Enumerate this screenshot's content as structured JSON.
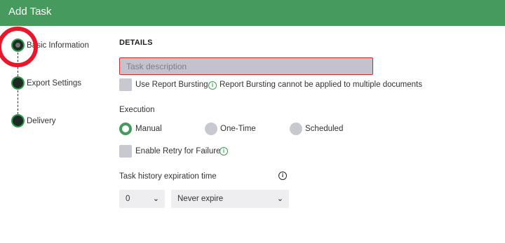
{
  "window": {
    "title": "Add Task"
  },
  "stepper": {
    "steps": [
      {
        "label": "Basic Information",
        "active": true
      },
      {
        "label": "Export Settings",
        "active": false
      },
      {
        "label": "Delivery",
        "active": false
      }
    ]
  },
  "details": {
    "section_title": "DETAILS",
    "task_description": {
      "value": "",
      "placeholder": "Task description"
    },
    "report_bursting": {
      "label": "Use Report Bursting",
      "checked": false,
      "note": "Report Bursting cannot be applied to multiple documents"
    },
    "execution": {
      "label": "Execution",
      "options": [
        {
          "label": "Manual",
          "selected": true
        },
        {
          "label": "One-Time",
          "selected": false
        },
        {
          "label": "Scheduled",
          "selected": false
        }
      ]
    },
    "retry": {
      "label": "Enable Retry for Failure",
      "checked": false
    },
    "history": {
      "label": "Task history expiration time",
      "amount": "0",
      "unit": "Never expire"
    }
  },
  "colors": {
    "accent": "#479a5d",
    "annotation": "#e8172b",
    "error_border": "#cc2b2b"
  },
  "icons": {
    "info_green": "info-icon",
    "info_dark": "info-icon",
    "chevron": "chevron-down-icon"
  }
}
